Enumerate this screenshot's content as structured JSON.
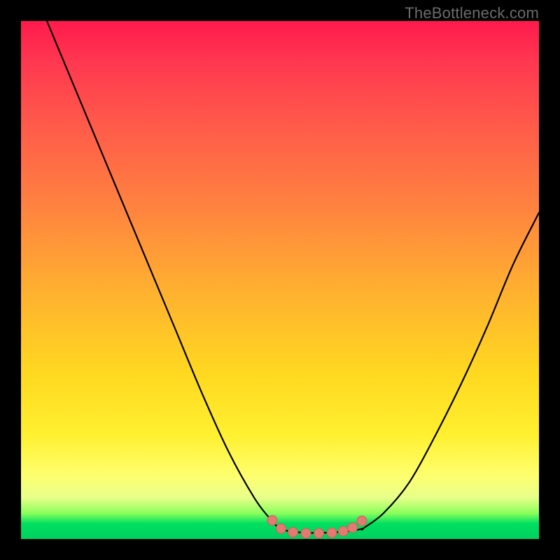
{
  "watermark": "TheBottleneck.com",
  "colors": {
    "page_bg": "#000000",
    "curve_stroke": "#000000",
    "marker_fill": "#e27a72",
    "marker_stroke": "#c96058"
  },
  "chart_data": {
    "type": "line",
    "title": "",
    "xlabel": "",
    "ylabel": "",
    "xlim": [
      0,
      100
    ],
    "ylim": [
      0,
      100
    ],
    "series": [
      {
        "name": "left-branch",
        "x": [
          5,
          10,
          15,
          20,
          25,
          30,
          35,
          40,
          45,
          48,
          50
        ],
        "y": [
          100,
          88,
          76,
          64,
          52,
          40,
          28,
          17,
          8,
          4,
          2
        ]
      },
      {
        "name": "right-branch",
        "x": [
          66,
          70,
          75,
          80,
          85,
          90,
          95,
          100
        ],
        "y": [
          2,
          5,
          11,
          20,
          30,
          41,
          53,
          63
        ]
      },
      {
        "name": "valley-flat",
        "x": [
          50,
          52,
          55,
          58,
          61,
          64,
          66
        ],
        "y": [
          2,
          1.5,
          1.2,
          1.2,
          1.3,
          1.6,
          2
        ]
      }
    ],
    "markers": {
      "name": "valley-dots",
      "points": [
        {
          "x": 48.5,
          "y": 3.6
        },
        {
          "x": 50.2,
          "y": 2.0
        },
        {
          "x": 52.5,
          "y": 1.3
        },
        {
          "x": 55.0,
          "y": 1.1
        },
        {
          "x": 57.5,
          "y": 1.1
        },
        {
          "x": 60.0,
          "y": 1.2
        },
        {
          "x": 62.2,
          "y": 1.5
        },
        {
          "x": 64.0,
          "y": 2.2
        },
        {
          "x": 65.8,
          "y": 3.5
        }
      ],
      "radius_px": 7
    }
  }
}
